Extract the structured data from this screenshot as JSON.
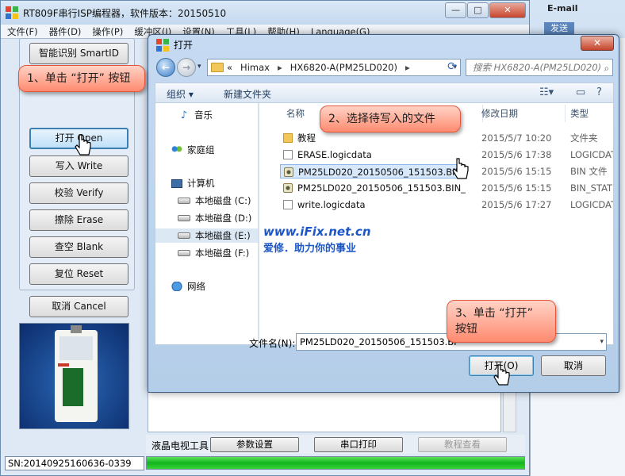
{
  "app": {
    "title": "RT809F串行ISP编程器，软件版本：20150510",
    "menu": [
      "文件(F)",
      "器件(D)",
      "操作(P)",
      "缓冲区(I)",
      "设置(N)",
      "工具(L)",
      "帮助(H)",
      "Language(G)"
    ],
    "side_buttons": {
      "smartid": "智能识别 SmartID",
      "open": "打开 Open",
      "write": "写入 Write",
      "verify": "校验 Verify",
      "erase": "擦除 Erase",
      "blank": "查空 Blank",
      "reset": "复位 Reset",
      "cancel": "取消 Cancel"
    },
    "status_sn": "SN:20140925160636-0339",
    "bottom": {
      "lcd_tool": "液晶电视工具",
      "params": "参数设置",
      "serial": "串口打印",
      "tutorial": "教程查看"
    },
    "progress_value": 1.0
  },
  "email": {
    "label": "E-mail",
    "send": "发送"
  },
  "dialog": {
    "title": "打开",
    "address": [
      "«",
      "Himax",
      "HX6820-A(PM25LD020)"
    ],
    "search_placeholder": "搜索 HX6820-A(PM25LD020)",
    "organize": "组织 ▾",
    "new_folder": "新建文件夹",
    "nav": {
      "music": "音乐",
      "homegroup": "家庭组",
      "computer": "计算机",
      "disk_c": "本地磁盘 (C:)",
      "disk_d": "本地磁盘 (D:)",
      "disk_e": "本地磁盘 (E:)",
      "disk_f": "本地磁盘 (F:)",
      "network": "网络"
    },
    "columns": {
      "name": "名称",
      "date": "修改日期",
      "type": "类型"
    },
    "files": [
      {
        "name": "教程",
        "date": "2015/5/7 10:20",
        "type": "文件夹",
        "icon": "folder"
      },
      {
        "name": "ERASE.logicdata",
        "date": "2015/5/6 17:38",
        "type": "LOGICDATA",
        "icon": "doc"
      },
      {
        "name": "PM25LD020_20150506_151503.BIN",
        "date": "2015/5/6 15:15",
        "type": "BIN 文件",
        "icon": "bin"
      },
      {
        "name": "PM25LD020_20150506_151503.BIN_",
        "date": "2015/5/6 15:15",
        "type": "BIN_STATUS",
        "icon": "bin"
      },
      {
        "name": "write.logicdata",
        "date": "2015/5/6 17:27",
        "type": "LOGICDATA",
        "icon": "doc"
      }
    ],
    "filename_label": "文件名(N):",
    "filename_value": "PM25LD020_20150506_151503.BI",
    "open_button": "打开(O)",
    "cancel_button": "取消"
  },
  "callouts": {
    "step1": "1、单击 “打开” 按钮",
    "step2": "2、选择待写入的文件",
    "step3": "3、单击 “打开” 按钮"
  },
  "watermark": {
    "url": "www.iFix.net.cn",
    "slogan": "爱修．助力你的事业"
  },
  "colors": {
    "accent": "#3c7fb1",
    "callout": "#ff8a6f",
    "watermark": "#1b57c8",
    "progress": "#13b41d"
  }
}
